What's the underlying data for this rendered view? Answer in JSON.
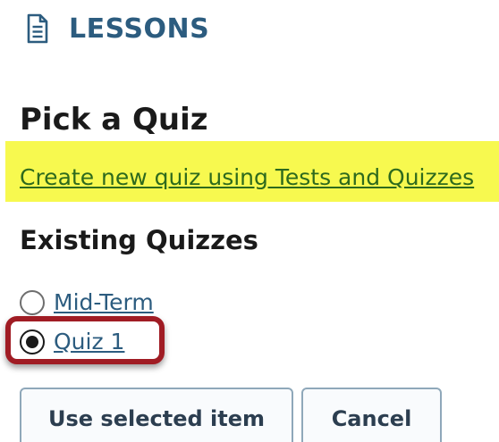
{
  "header": {
    "icon": "document-icon",
    "title": "LESSONS"
  },
  "page": {
    "title": "Pick a Quiz",
    "create_link": "Create new quiz using Tests and Quizzes"
  },
  "existing": {
    "title": "Existing Quizzes",
    "options": [
      {
        "label": "Mid-Term",
        "selected": false
      },
      {
        "label": "Quiz 1",
        "selected": true
      }
    ]
  },
  "actions": {
    "use_selected_label": "Use selected item",
    "cancel_label": "Cancel"
  },
  "colors": {
    "header_text": "#2c5c7f",
    "link_highlight": "#f7f94f",
    "create_link": "#2e6a1d",
    "selection_callout": "#a01c24",
    "button_border": "#8fa8ba"
  }
}
